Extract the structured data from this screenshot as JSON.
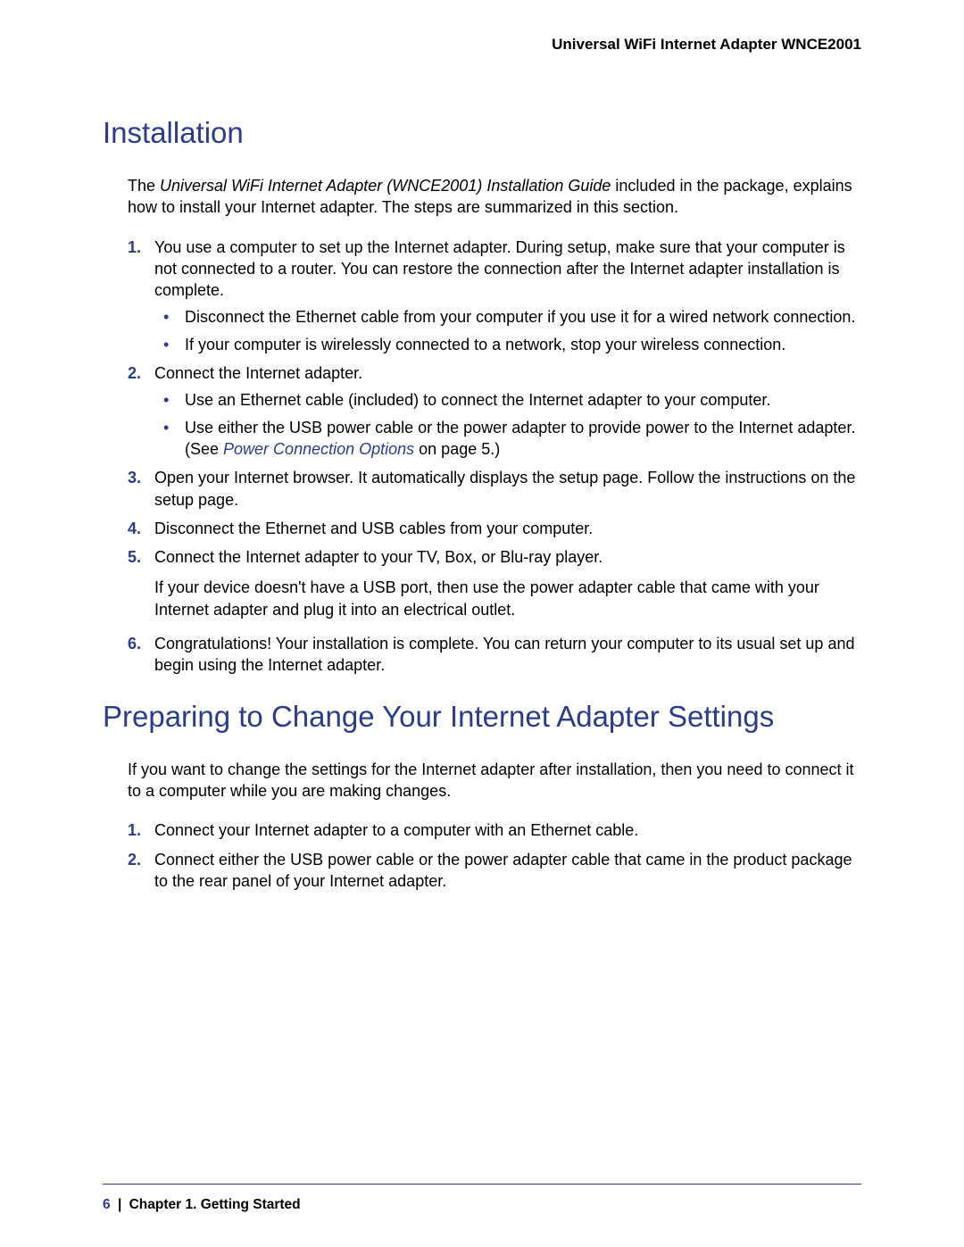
{
  "header": {
    "product": "Universal WiFi Internet Adapter WNCE2001"
  },
  "section1": {
    "title": "Installation",
    "intro_pre": "The ",
    "intro_italic": "Universal WiFi Internet Adapter (WNCE2001) Installation Guide",
    "intro_post": " included in the package, explains how to install your Internet adapter. The steps are summarized in this section.",
    "step1_num": "1.",
    "step1": "You use a computer to set up the Internet adapter. During setup, make sure that your computer is not connected to a router. You can restore the connection after the Internet adapter installation is complete.",
    "step1_sub1": "Disconnect the Ethernet cable from your computer if you use it for a wired network connection.",
    "step1_sub2": "If your computer is wirelessly connected to a network, stop your wireless connection.",
    "step2_num": "2.",
    "step2": "Connect the Internet adapter.",
    "step2_sub1": "Use an Ethernet cable (included) to connect the Internet adapter to your computer.",
    "step2_sub2_pre": "Use either the USB power cable or the power adapter to provide power to the Internet adapter. (See ",
    "step2_sub2_link": "Power Connection Options",
    "step2_sub2_post": " on page 5.)",
    "step3_num": "3.",
    "step3": "Open your Internet browser. It automatically displays the setup page. Follow the instructions on the setup page.",
    "step4_num": "4.",
    "step4": "Disconnect the Ethernet and USB cables from your computer.",
    "step5_num": "5.",
    "step5": "Connect the Internet adapter to your TV, Box, or Blu-ray player.",
    "step5_para": "If your device doesn't have a USB port, then use the power adapter cable that came with your Internet adapter and plug it into an electrical outlet.",
    "step6_num": "6.",
    "step6": "Congratulations! Your installation is complete. You can return your computer to its usual set up and begin using the Internet adapter."
  },
  "section2": {
    "title": "Preparing to Change Your Internet Adapter Settings",
    "intro": "If you want to change the settings for the Internet adapter after installation, then you need to connect it to a computer while you are making changes.",
    "step1_num": "1.",
    "step1": "Connect your Internet adapter to a computer with an Ethernet cable.",
    "step2_num": "2.",
    "step2": "Connect either the USB power cable or the power adapter cable that came in the product package to the rear panel of your Internet adapter."
  },
  "footer": {
    "page": "6",
    "sep": "|",
    "chapter": "Chapter 1.  Getting Started"
  }
}
